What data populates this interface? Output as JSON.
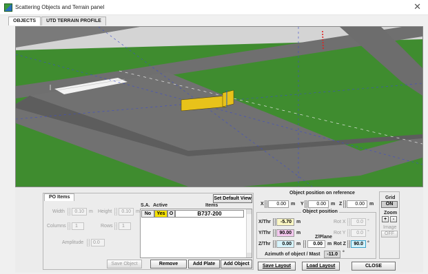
{
  "window": {
    "title": "Scattering Objects and Terrain panel",
    "close_glyph": "✕"
  },
  "tabs": [
    {
      "label": "OBJECTS"
    },
    {
      "label": "UTD TERRAIN PROFILE"
    }
  ],
  "po_items": {
    "tab_label": "PO Items",
    "width_label": "Width",
    "width_value": "0.10",
    "width_unit": "m",
    "height_label": "Height",
    "height_value": "0.10",
    "height_unit": "m",
    "columns_label": "Columns",
    "columns_value": "1",
    "rows_label": "Rows",
    "rows_value": "1",
    "amplitude_label": "Amplitude",
    "amplitude_value": "0.0"
  },
  "list": {
    "set_default_label": "Set Default View",
    "sa_header": "S.A.",
    "active_header": "Active",
    "items_header": "Items",
    "rows": [
      {
        "sa": "No",
        "active": "Yes",
        "o": "O",
        "item": "B737-200"
      }
    ]
  },
  "actions": {
    "save_object": "Save Object",
    "remove": "Remove",
    "add_plate": "Add Plate",
    "add_object": "Add Object"
  },
  "reference": {
    "title": "Object  position on reference",
    "x_label": "X",
    "x_value": "0.00",
    "x_unit": "m",
    "y_label": "Y",
    "y_value": "0.00",
    "y_unit": "m",
    "z_label": "Z",
    "z_value": "0.00",
    "z_unit": "m"
  },
  "position": {
    "title": "Object position",
    "xthr_label": "X/Thr",
    "xthr_value": "-5.70",
    "xthr_unit": "m",
    "ythr_label": "Y/Thr",
    "ythr_value": "90.00",
    "ythr_unit": "m",
    "zthr_label": "Z/Thr",
    "zthr_value": "0.00",
    "zthr_unit": "m",
    "zplane_label": "Z/Plane",
    "zplane_value": "0.00",
    "zplane_unit": "m",
    "rotx_label": "Rot X",
    "rotx_value": "0.0",
    "rotx_unit": "°",
    "roty_label": "Rot Y",
    "roty_value": "0.0",
    "roty_unit": "°",
    "rotz_label": "Rot Z",
    "rotz_value": "90.0",
    "rotz_unit": "°",
    "azimuth_label": "Azimuth of object / Mast",
    "azimuth_value": "-11.0",
    "azimuth_unit": "°"
  },
  "grid": {
    "grid_label": "Grid",
    "grid_state": "ON",
    "zoom_label": "Zoom",
    "zoom_in": "+",
    "zoom_out": "-",
    "image_label": "Image",
    "image_state": "OFF"
  },
  "footer": {
    "save_layout": "Save Layout",
    "load_layout": "Load Layout",
    "close": "CLOSE"
  },
  "colors": {
    "grass": "#3f8c2f",
    "sky": "#d2d2d2",
    "runway": "#6f6f6f",
    "hangar": "#e8c21a",
    "ythr_highlight": "#f3c8ee",
    "yes_highlight": "#f5e100",
    "xthr_highlight": "#fbf7c4",
    "rotz_highlight": "#d6f3fb"
  }
}
